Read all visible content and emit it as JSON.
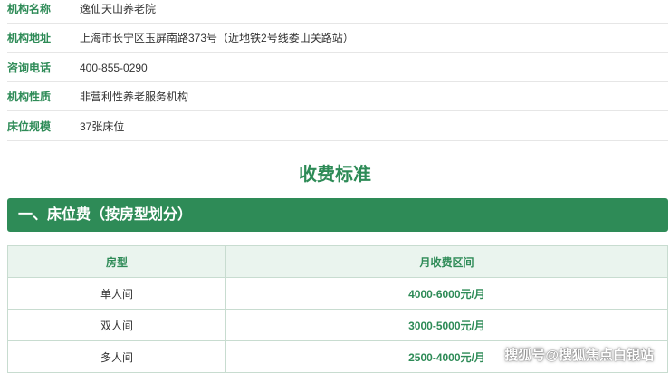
{
  "info": [
    {
      "label": "机构名称",
      "value": "逸仙天山养老院"
    },
    {
      "label": "机构地址",
      "value": "上海市长宁区玉屏南路373号（近地铁2号线娄山关路站）"
    },
    {
      "label": "咨询电话",
      "value": "400-855-0290"
    },
    {
      "label": "机构性质",
      "value": "非营利性养老服务机构"
    },
    {
      "label": "床位规模",
      "value": "37张床位"
    }
  ],
  "section_title": "收费标准",
  "section_header": "一、床位费（按房型划分）",
  "table": {
    "headers": [
      "房型",
      "月收费区间"
    ],
    "rows": [
      {
        "type": "单人间",
        "price": "4000-6000元/月"
      },
      {
        "type": "双人间",
        "price": "3000-5000元/月"
      },
      {
        "type": "多人间",
        "price": "2500-4000元/月"
      }
    ]
  },
  "watermark": "搜狐号@搜狐焦点白银站",
  "colors": {
    "accent": "#2e8b57",
    "header_bg": "#eaf4ee",
    "border": "#c8dcd0"
  }
}
